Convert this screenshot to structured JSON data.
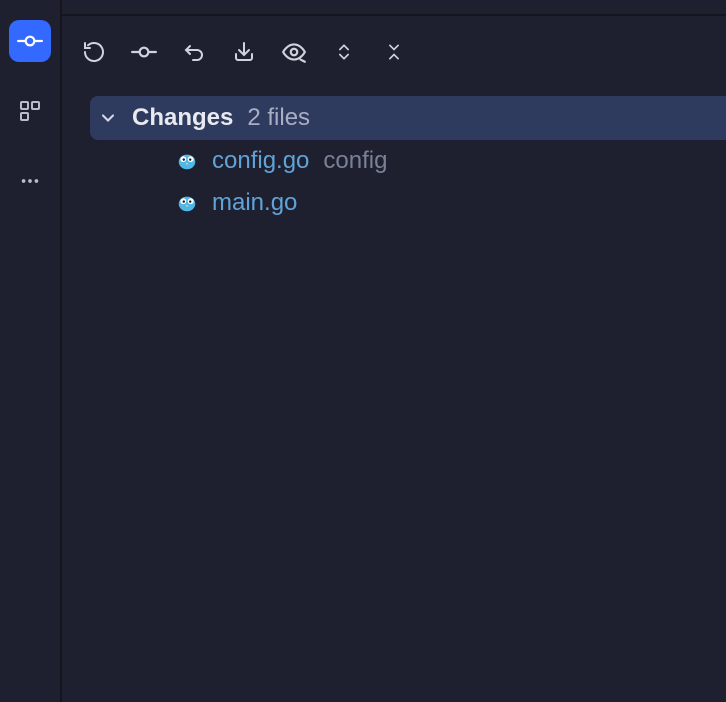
{
  "rail": {
    "items": [
      {
        "name": "commit-icon",
        "active": true
      },
      {
        "name": "apps-icon",
        "active": false
      },
      {
        "name": "more-icon",
        "active": false
      }
    ]
  },
  "toolbar": {
    "items": [
      {
        "name": "refresh-icon"
      },
      {
        "name": "commit-node-icon"
      },
      {
        "name": "undo-icon"
      },
      {
        "name": "stash-icon"
      },
      {
        "name": "preview-icon"
      },
      {
        "name": "expand-collapse-icon"
      },
      {
        "name": "close-group-icon"
      }
    ]
  },
  "changes": {
    "label": "Changes",
    "count_text": "2 files",
    "files": [
      {
        "name": "config.go",
        "dir": "config",
        "icon": "go-file-icon"
      },
      {
        "name": "main.go",
        "dir": "",
        "icon": "go-file-icon"
      }
    ]
  }
}
